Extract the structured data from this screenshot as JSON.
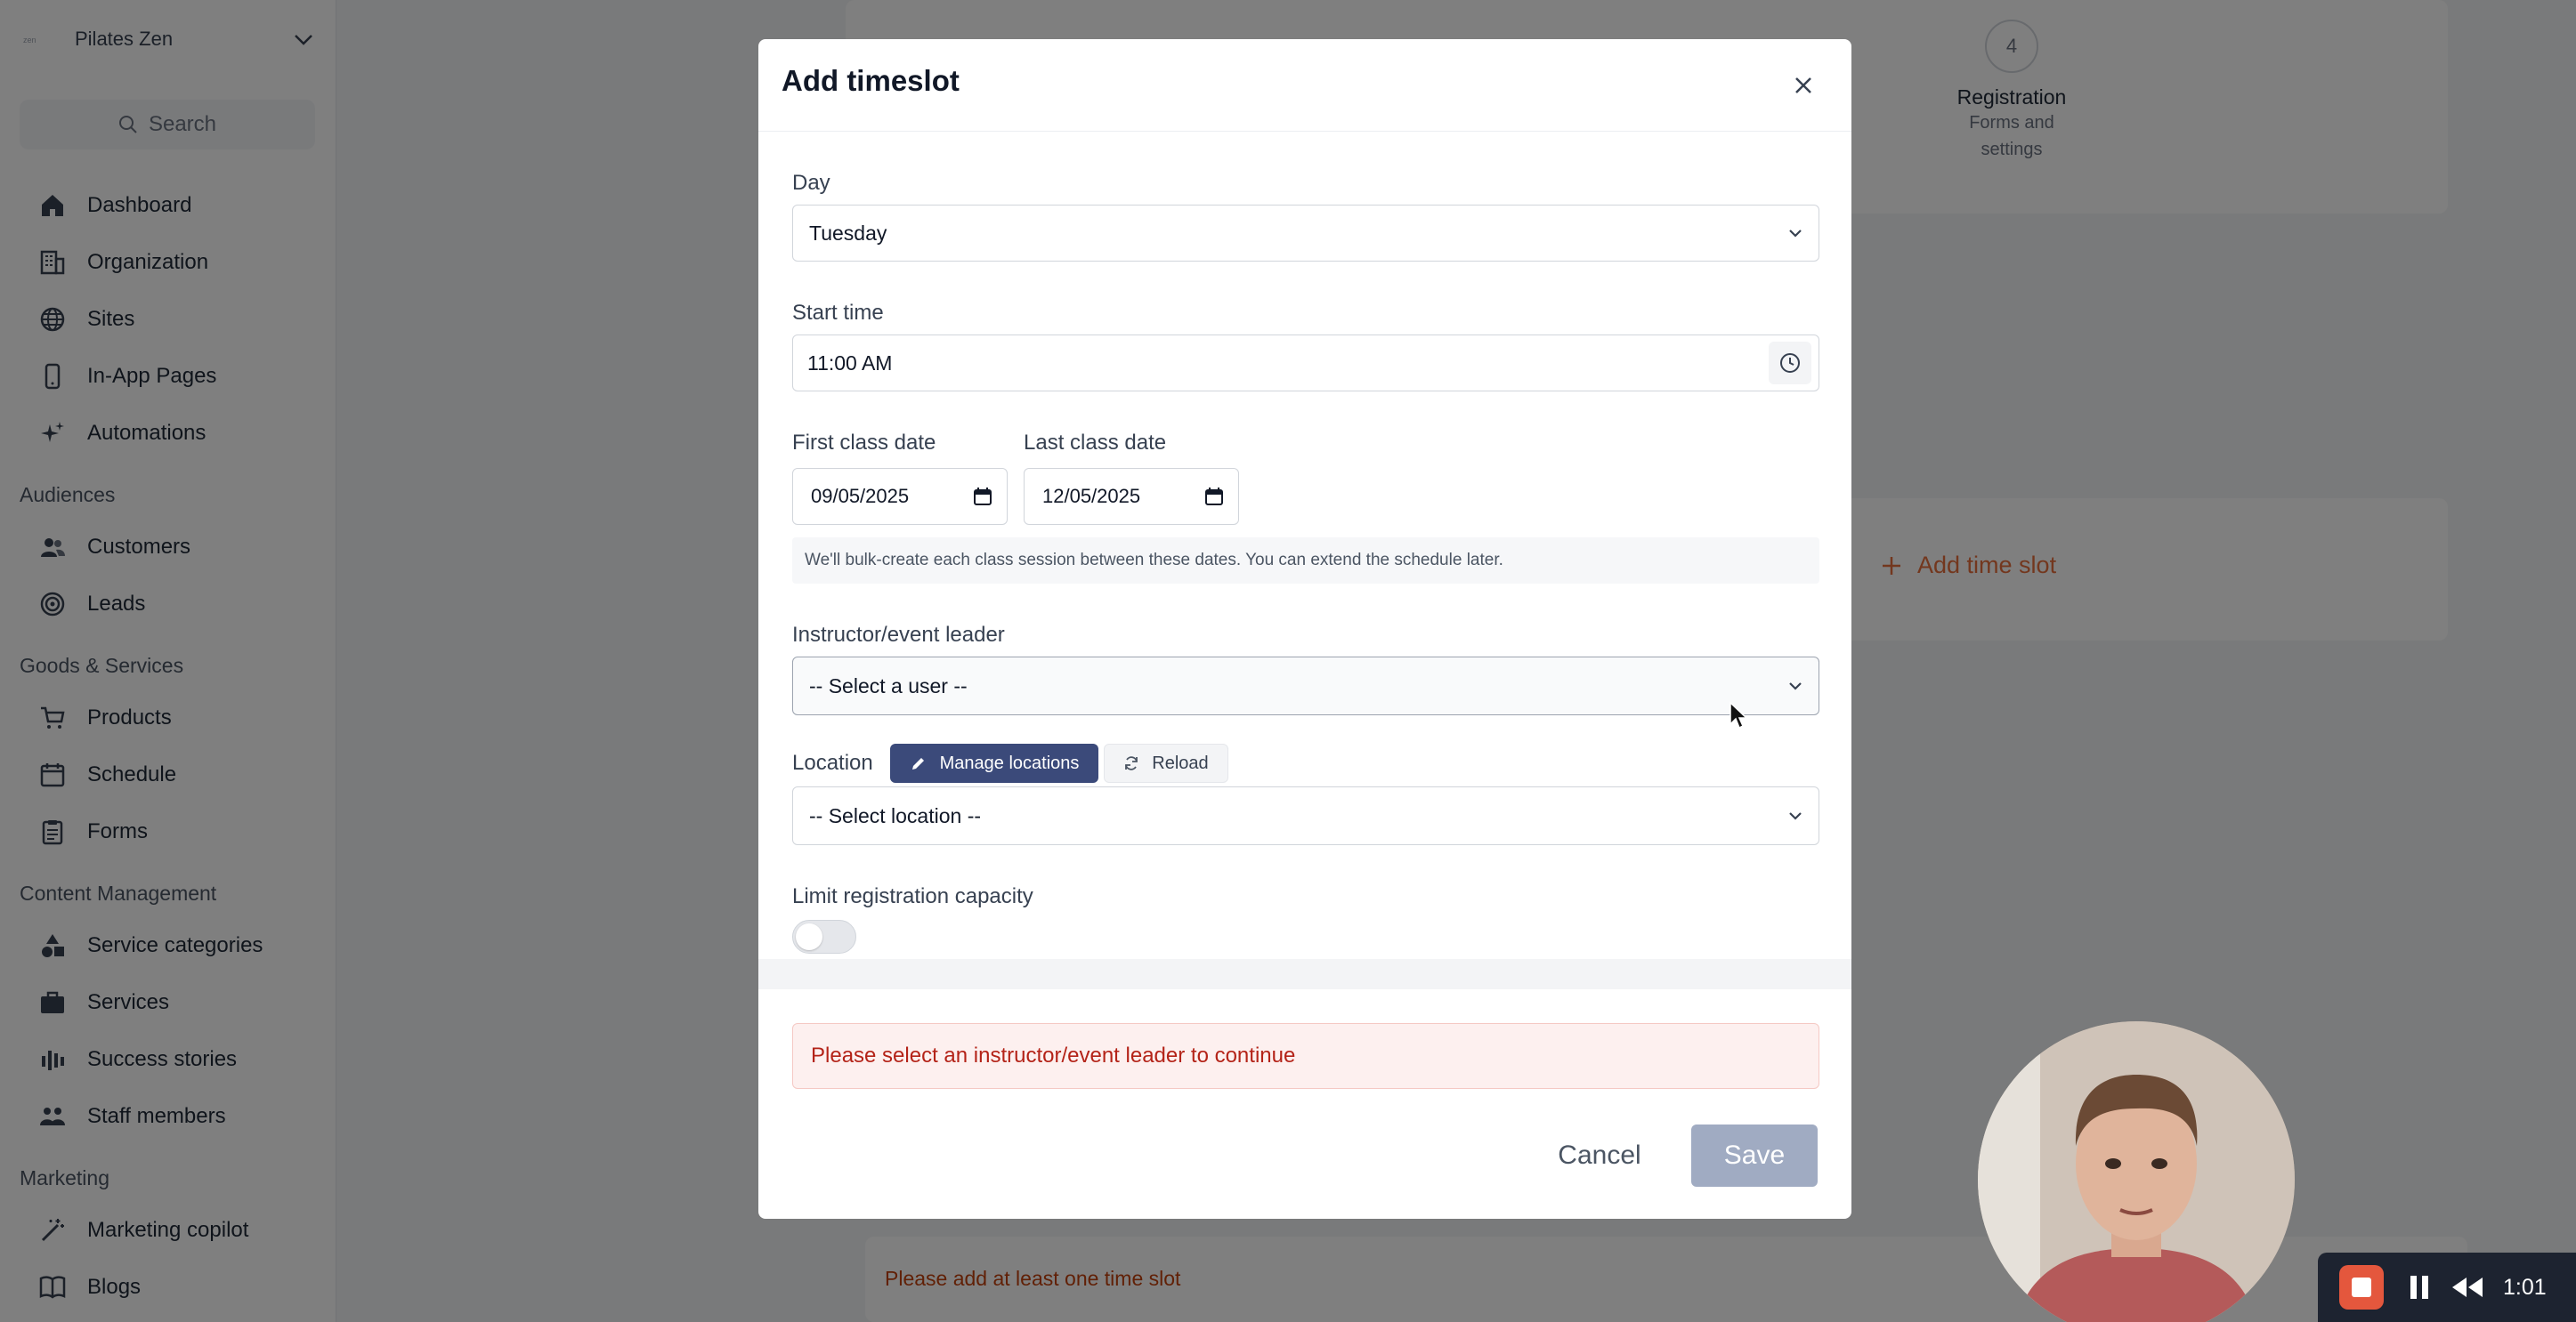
{
  "sidebar": {
    "org_name": "Pilates Zen",
    "search_label": "Search",
    "items": [
      {
        "label": "Dashboard",
        "icon": "home-icon"
      },
      {
        "label": "Organization",
        "icon": "building-icon"
      },
      {
        "label": "Sites",
        "icon": "globe-icon"
      },
      {
        "label": "In-App Pages",
        "icon": "phone-icon"
      },
      {
        "label": "Automations",
        "icon": "sparkles-icon"
      }
    ],
    "sections": [
      {
        "title": "Audiences",
        "items": [
          {
            "label": "Customers",
            "icon": "users-icon"
          },
          {
            "label": "Leads",
            "icon": "target-icon"
          }
        ]
      },
      {
        "title": "Goods & Services",
        "items": [
          {
            "label": "Products",
            "icon": "cart-icon"
          },
          {
            "label": "Schedule",
            "icon": "calendar-icon"
          },
          {
            "label": "Forms",
            "icon": "clipboard-icon"
          }
        ]
      },
      {
        "title": "Content Management",
        "items": [
          {
            "label": "Service categories",
            "icon": "shapes-icon"
          },
          {
            "label": "Services",
            "icon": "briefcase-icon"
          },
          {
            "label": "Success stories",
            "icon": "chart-icon"
          },
          {
            "label": "Staff members",
            "icon": "staff-icon"
          }
        ]
      },
      {
        "title": "Marketing",
        "items": [
          {
            "label": "Marketing copilot",
            "icon": "wand-icon"
          },
          {
            "label": "Blogs",
            "icon": "book-icon"
          }
        ]
      }
    ]
  },
  "background": {
    "step4": {
      "number": "4",
      "title": "Registration",
      "sub1": "Forms and",
      "sub2": "settings"
    },
    "add_slot_label": "Add time slot",
    "error_text": "Please add at least one time slot"
  },
  "modal": {
    "title": "Add timeslot",
    "day": {
      "label": "Day",
      "value": "Tuesday"
    },
    "start_time": {
      "label": "Start time",
      "value": "11:00  AM"
    },
    "first_date": {
      "label": "First class date",
      "value": "09/05/2025"
    },
    "last_date": {
      "label": "Last class date",
      "value": "12/05/2025"
    },
    "help_text": "We'll bulk-create each class session between these dates. You can extend the schedule later.",
    "instructor": {
      "label": "Instructor/event leader",
      "value": "-- Select a user --"
    },
    "location": {
      "label": "Location",
      "value": "-- Select location --",
      "manage_label": "Manage locations",
      "reload_label": "Reload"
    },
    "capacity": {
      "label": "Limit registration capacity",
      "enabled": false
    },
    "error_text": "Please select an instructor/event leader to continue",
    "cancel_label": "Cancel",
    "save_label": "Save"
  },
  "recorder": {
    "time": "1:01"
  },
  "colors": {
    "accent": "#3b4a7a",
    "save_disabled": "#a0abc2",
    "error": "#b42318",
    "orange": "#e76f3c"
  }
}
